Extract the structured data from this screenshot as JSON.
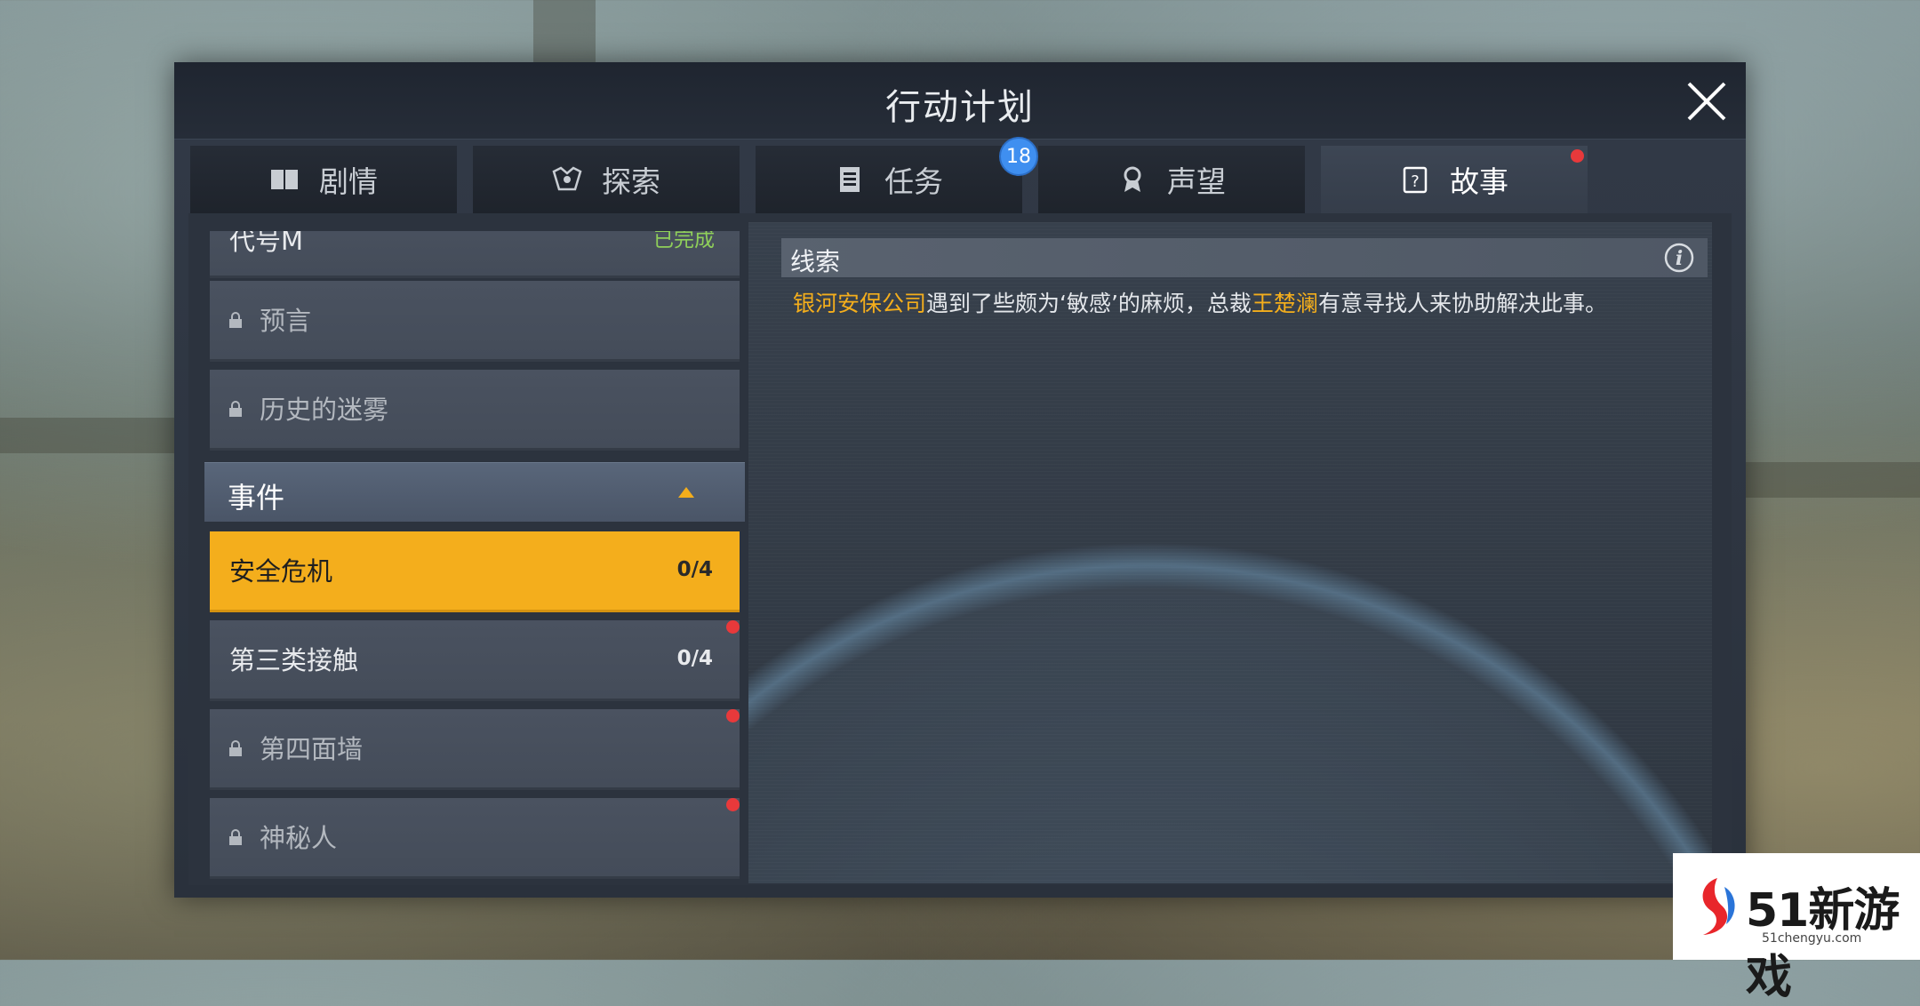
{
  "dialog": {
    "title": "行动计划"
  },
  "tabs": [
    {
      "label": "剧情",
      "icon": "book-icon"
    },
    {
      "label": "探索",
      "icon": "explore-icon"
    },
    {
      "label": "任务",
      "icon": "task-list-icon",
      "badge": "18"
    },
    {
      "label": "声望",
      "icon": "reputation-icon"
    },
    {
      "label": "故事",
      "icon": "story-icon",
      "active": true,
      "notification": true
    }
  ],
  "left_list": {
    "items_top": [
      {
        "label": "代号M",
        "status": "已完成"
      },
      {
        "label": "预言",
        "locked": true
      },
      {
        "label": "历史的迷雾",
        "locked": true
      }
    ],
    "section": {
      "title": "事件",
      "expanded": true
    },
    "events": [
      {
        "label": "安全危机",
        "count": "0/4",
        "selected": true
      },
      {
        "label": "第三类接触",
        "count": "0/4",
        "notification": true
      },
      {
        "label": "第四面墙",
        "locked": true,
        "notification": true
      },
      {
        "label": "神秘人",
        "locked": true,
        "notification": true
      }
    ]
  },
  "clue": {
    "title": "线索",
    "text_parts": {
      "highlight1": "银河安保公司",
      "middle": "遇到了些颇为‘敏感’的麻烦，总裁",
      "highlight2": "王楚澜",
      "end": "有意寻找人来协助解决此事。"
    }
  },
  "watermark": {
    "brand": "51新游戏",
    "url": "51chengyu.com"
  },
  "colors": {
    "accent": "#f4ae1c",
    "completed": "#8fcf5a",
    "badge": "#3f8ff0",
    "notification": "#e8393b"
  }
}
